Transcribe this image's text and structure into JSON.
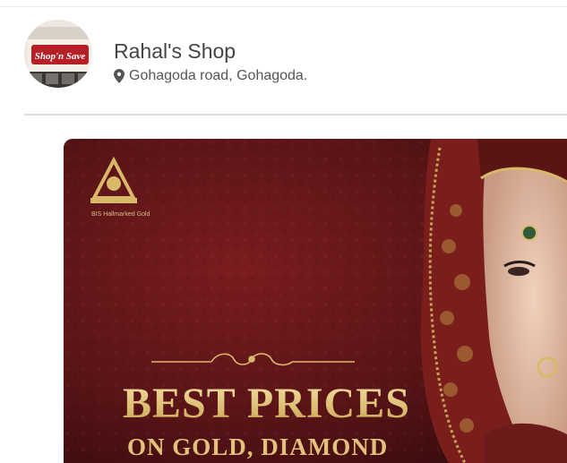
{
  "shop": {
    "name": "Rahal's Shop",
    "address": "Gohagoda road, Gohagoda.",
    "avatar_sign_text": "Shop'n Save",
    "address_icon": "map-marker-icon"
  },
  "banner": {
    "hallmark_caption": "BIS Hallmarked Gold",
    "headline": "BEST PRICES",
    "subline": "ON GOLD, DIAMOND",
    "colors": {
      "background": "#5e1518",
      "gold": "#d9b868"
    }
  }
}
